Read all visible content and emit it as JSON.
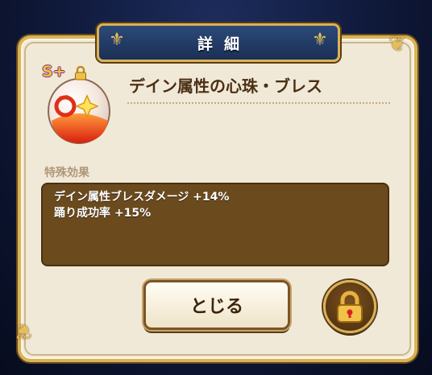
{
  "header": {
    "title": "詳細"
  },
  "item": {
    "name": "デイン属性の心珠・ブレス",
    "rank": "S+",
    "rank_color": "#f0c040",
    "icon": "orb-egg-icon",
    "accent_color": "#e43a1c"
  },
  "effects": {
    "label": "特殊効果",
    "lines": [
      "デイン属性ブレスダメージ +14%",
      "踊り成功率 +15%"
    ]
  },
  "buttons": {
    "close_label": "とじる",
    "lock_icon": "lock-icon"
  },
  "colors": {
    "panel": "#f1e9d8",
    "frame_gold": "#d8b35a",
    "effects_bg": "#6b4a1e",
    "banner_blue": "#2c4a78"
  }
}
